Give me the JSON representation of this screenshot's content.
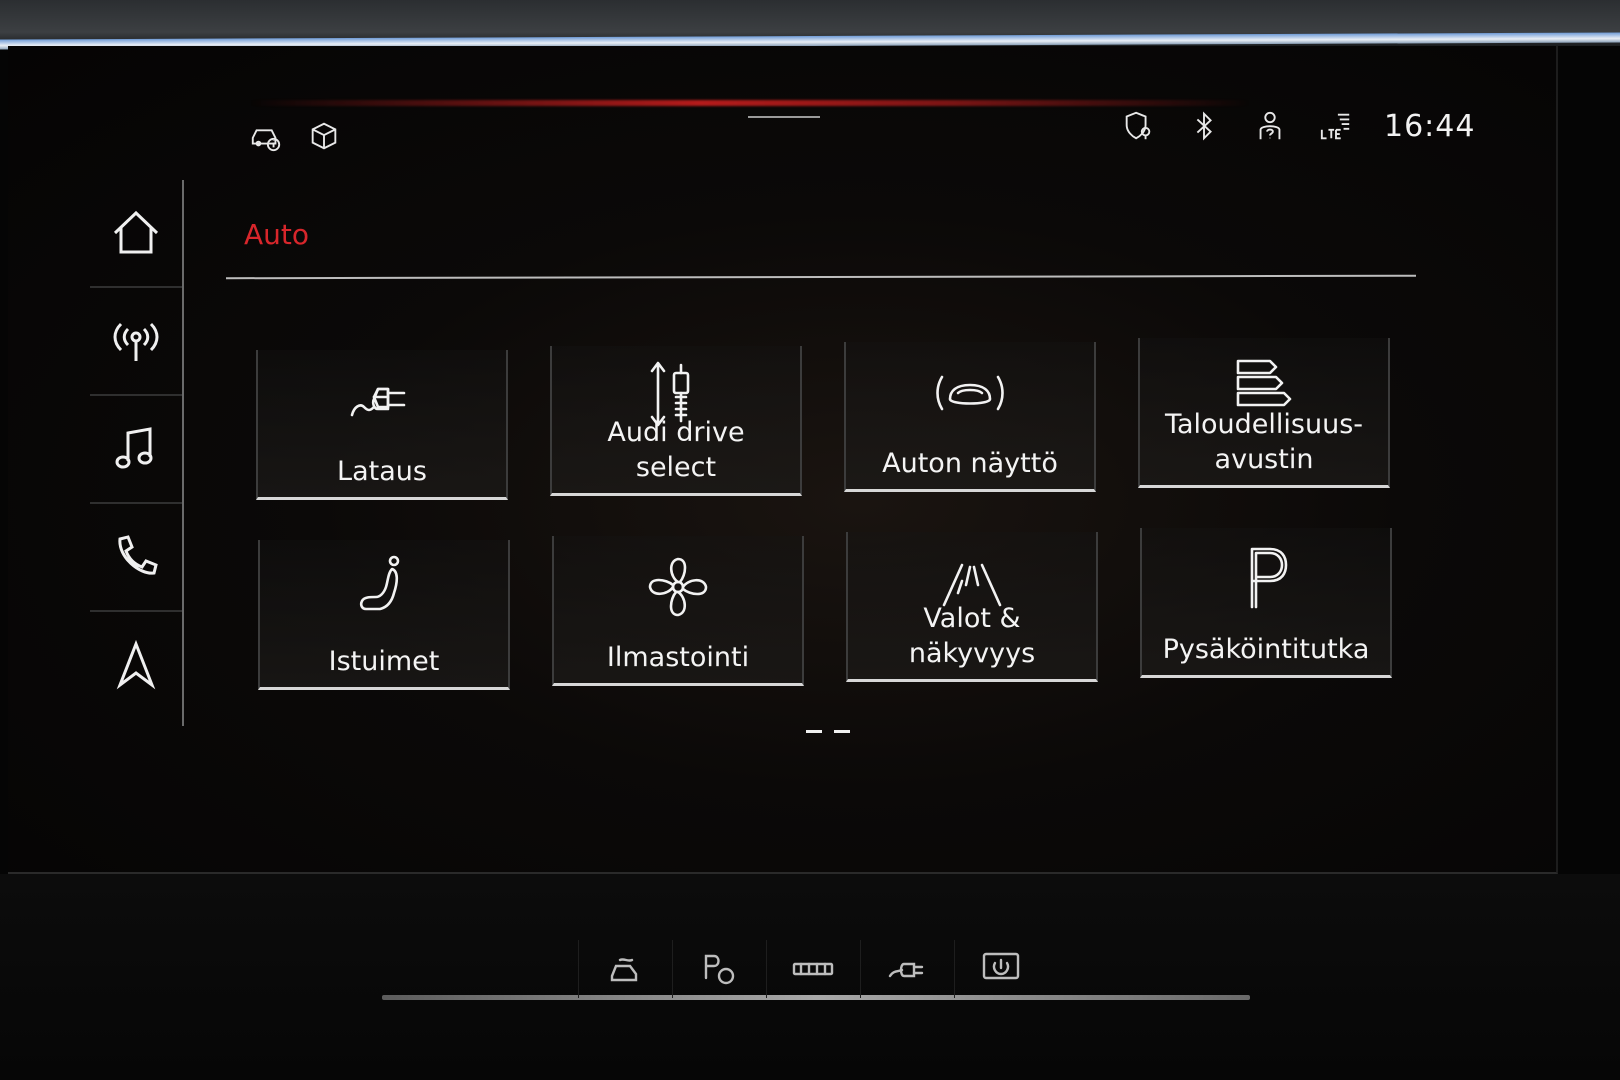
{
  "status_bar": {
    "time": "16:44",
    "left_icons": [
      "car-info-icon",
      "box-icon"
    ],
    "right_icons": [
      "location-shield-icon",
      "bluetooth-icon",
      "user-question-icon",
      "lte-signal-icon"
    ]
  },
  "sidebar": {
    "items": [
      {
        "name": "home",
        "icon": "home-icon"
      },
      {
        "name": "radio",
        "icon": "radio-antenna-icon"
      },
      {
        "name": "media",
        "icon": "music-note-icon"
      },
      {
        "name": "phone",
        "icon": "phone-icon"
      },
      {
        "name": "navigation",
        "icon": "navigation-arrow-icon"
      }
    ]
  },
  "page": {
    "title": "Auto",
    "title_color": "#d8262b"
  },
  "tiles": [
    {
      "label": "Lataus",
      "icon": "charging-plug-icon"
    },
    {
      "label": "Audi drive\nselect",
      "icon": "suspension-icon"
    },
    {
      "label": "Auton näyttö",
      "icon": "car-view-icon"
    },
    {
      "label": "Taloudellisuus-\navustin",
      "icon": "efficiency-arrows-icon"
    },
    {
      "label": "Istuimet",
      "icon": "seat-icon"
    },
    {
      "label": "Ilmastointi",
      "icon": "fan-icon"
    },
    {
      "label": "Valot &\nnäkyvyys",
      "icon": "lights-road-icon"
    },
    {
      "label": "Pysäköintitutka",
      "icon": "parking-p-icon"
    }
  ],
  "pager": {
    "pages": 2,
    "current": 1
  },
  "console_buttons": [
    {
      "name": "drive-mode",
      "icon": "car-wave-icon"
    },
    {
      "name": "park-assist",
      "icon": "parking-sensor-icon"
    },
    {
      "name": "rear-defrost",
      "icon": "hazard-strip-icon"
    },
    {
      "name": "charge-port",
      "icon": "plug-icon"
    },
    {
      "name": "display-power",
      "icon": "screen-power-icon"
    }
  ],
  "colors": {
    "accent": "#d8262b",
    "text": "#f4f4f4",
    "background": "#050505"
  }
}
